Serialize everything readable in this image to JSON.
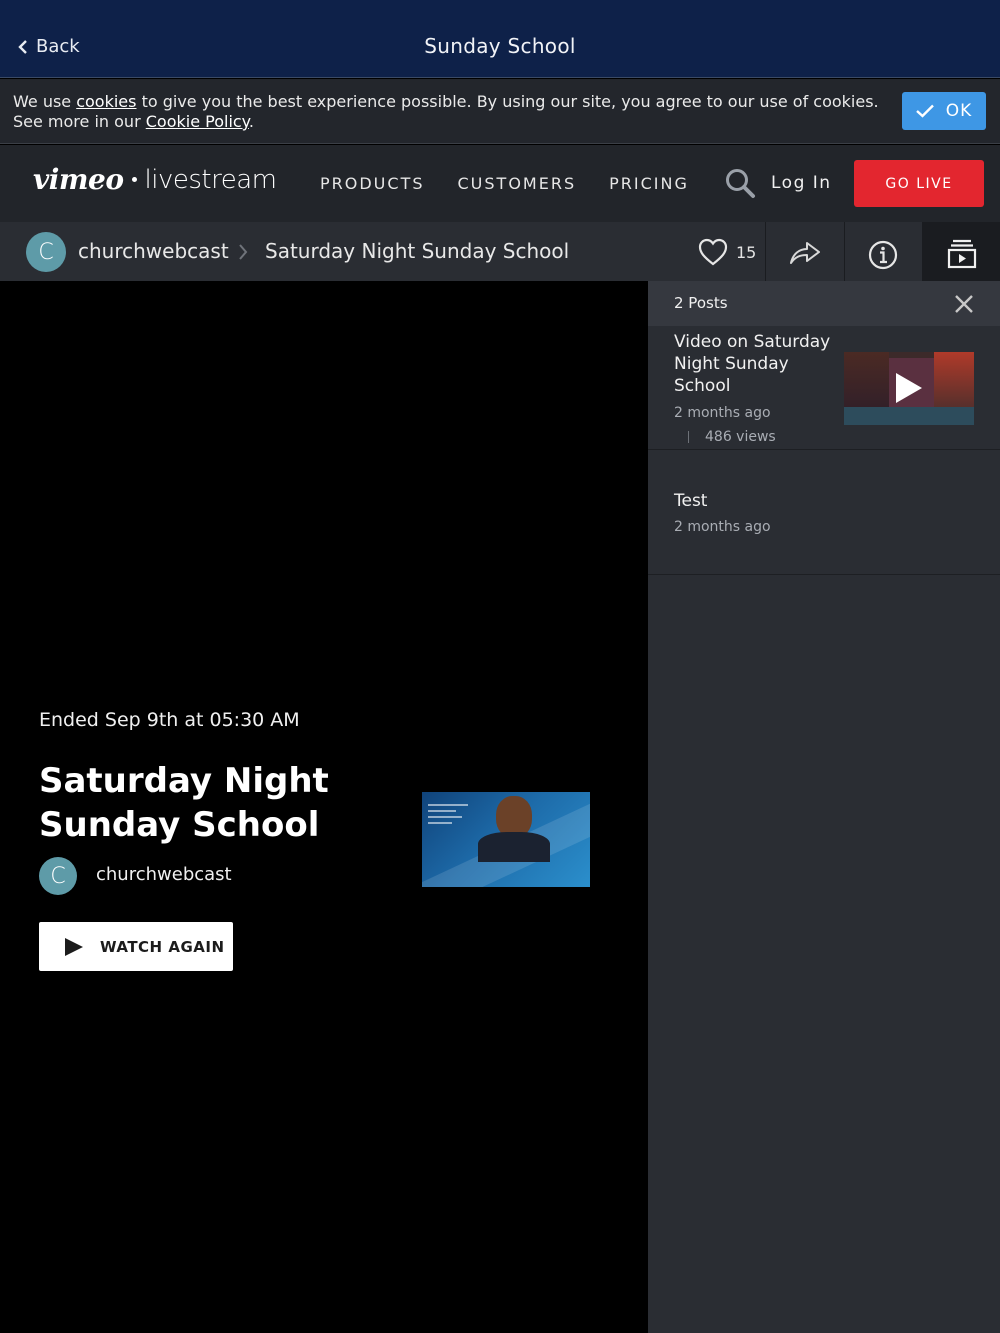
{
  "appbar": {
    "back_label": "Back",
    "title": "Sunday School"
  },
  "cookie_banner": {
    "text_1": "We use ",
    "link_cookies": "cookies",
    "text_2": " to give you the best experience possible. By using our site, you agree to our use of cookies. See more in our ",
    "link_policy": "Cookie Policy",
    "text_3": ".",
    "ok_label": "OK"
  },
  "nav": {
    "logo_vimeo": "vimeo",
    "logo_livestream": "livestream",
    "links": [
      "PRODUCTS",
      "CUSTOMERS",
      "PRICING"
    ],
    "login_label": "Log In",
    "go_live_label": "GO LIVE",
    "go_live_color": "#e3262f"
  },
  "channel_bar": {
    "avatar_initial": "C",
    "channel_name": "churchwebcast",
    "event_name": "Saturday Night Sunday School",
    "like_count": "15",
    "avatar_color": "#5e9ba8"
  },
  "player": {
    "status": "Ended Sep 9th at 05:30 AM",
    "title": "Saturday Night Sunday School",
    "avatar_initial": "C",
    "channel_name": "churchwebcast",
    "watch_again_label": "WATCH AGAIN"
  },
  "posts_panel": {
    "count_label": "2 Posts",
    "posts": [
      {
        "title": "Video on Saturday Night Sunday School",
        "time": "2 months ago",
        "views": "486 views"
      },
      {
        "title": "Test",
        "time": "2 months ago"
      }
    ]
  }
}
